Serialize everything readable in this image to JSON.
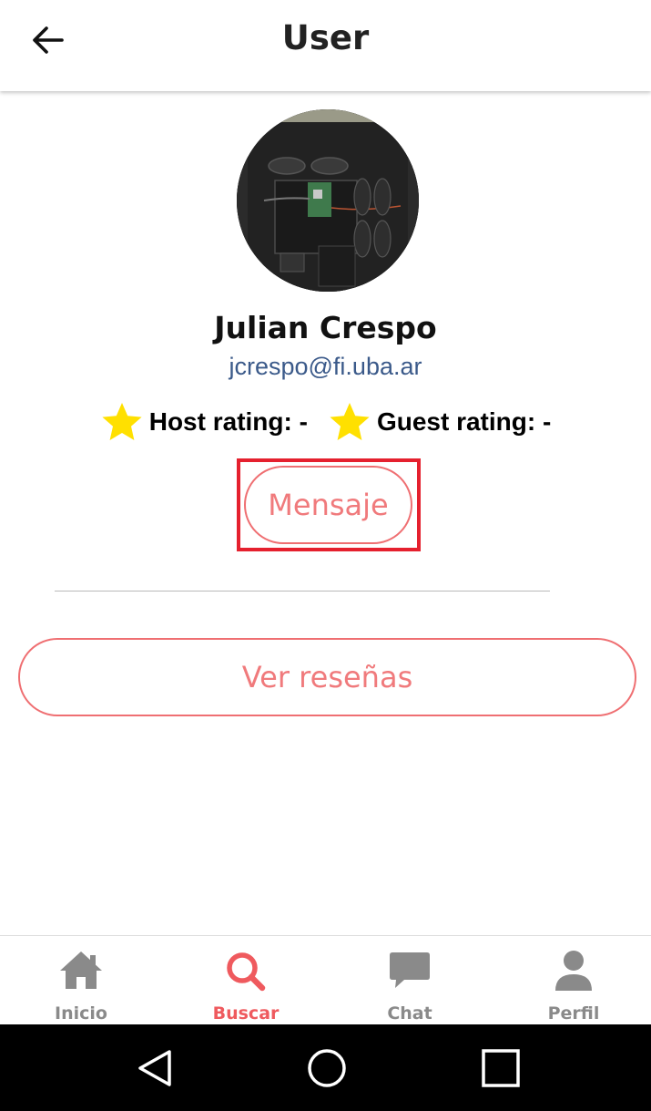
{
  "header": {
    "title": "User"
  },
  "profile": {
    "name": "Julian Crespo",
    "email": "jcrespo@fi.uba.ar",
    "host_rating_label": "Host rating: -",
    "guest_rating_label": "Guest rating: -",
    "star_color": "#FFE000"
  },
  "actions": {
    "message_label": "Mensaje",
    "reviews_label": "Ver reseñas",
    "accent_color": "#EF6F72",
    "highlight_color": "#E5202E"
  },
  "bottom_nav": {
    "items": [
      {
        "label": "Inicio",
        "icon": "home-icon"
      },
      {
        "label": "Buscar",
        "icon": "search-icon",
        "active": true
      },
      {
        "label": "Chat",
        "icon": "chat-icon"
      },
      {
        "label": "Perfil",
        "icon": "person-icon"
      }
    ],
    "active_color": "#EF5A5E",
    "inactive_color": "#8A8A8A"
  },
  "system_nav": {
    "buttons": [
      "back-triangle-icon",
      "home-circle-icon",
      "recents-square-icon"
    ]
  }
}
